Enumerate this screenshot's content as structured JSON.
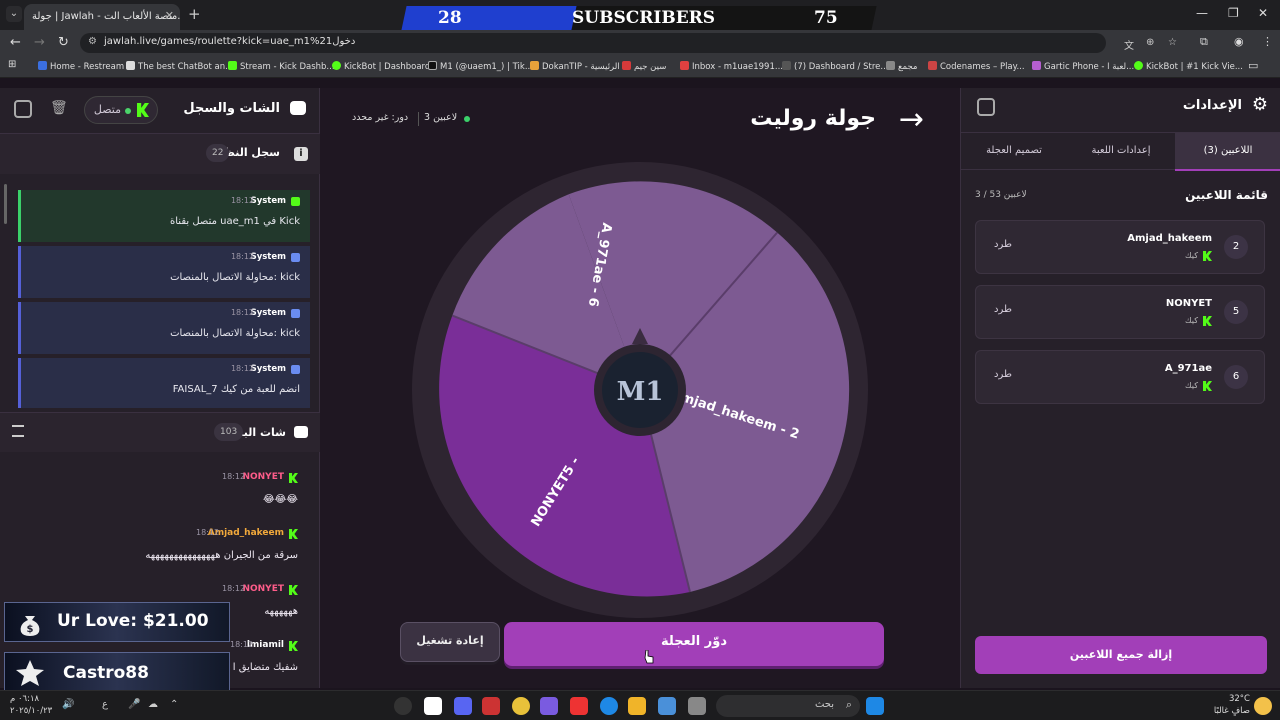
{
  "browser": {
    "tab_title": "جولة | Jawlah - منصة الألعاب الت...",
    "url": "jawlah.live/games/roulette?kick=uae_m1%21دخول",
    "bookmarks": [
      "Home - Restream",
      "The best ChatBot an...",
      "Stream - Kick Dashb...",
      "KickBot | Dashboard",
      "M1 (@uaem1_) | Tik...",
      "DokanTIP - الرئيسية",
      "سين جيم",
      "Inbox - m1uae1991...",
      "(7) Dashboard / Stre...",
      "مجمع",
      "Codenames – Play...",
      "Gartic Phone - لعبة ا...",
      "KickBot | #1 Kick Vie..."
    ]
  },
  "subscribers_overlay": {
    "current": "28",
    "label": "SUBSCRIBERS",
    "goal": "75"
  },
  "chat_panel": {
    "title": "الشات والسجل",
    "status": "متصل",
    "system_log": {
      "title": "سجل النظام",
      "count": "22",
      "entries": [
        {
          "author": "System",
          "time": "18:12",
          "message": "متصل بقناة uae_m1 في Kick",
          "kind": "success"
        },
        {
          "author": "System",
          "time": "18:12",
          "message": "محاولة الاتصال بالمنصات: kick",
          "kind": "info"
        },
        {
          "author": "System",
          "time": "18:12",
          "message": "محاولة الاتصال بالمنصات: kick",
          "kind": "info"
        },
        {
          "author": "System",
          "time": "18:12",
          "message": "FAISAL_7 انضم للعبة من كيك",
          "kind": "info"
        }
      ]
    },
    "live_chat": {
      "title": "شات البث",
      "count": "103",
      "messages": [
        {
          "user": "NONYET‪‏",
          "time": "18:12",
          "text": "😂😂😂",
          "color": "#ff5c8a"
        },
        {
          "user": "Amjad_hakeem",
          "time": "18:12",
          "text": "سرقة من الجيران هههههههههههههههه",
          "color": "#f2a93b"
        },
        {
          "user": "NONYET‪‏",
          "time": "18:12",
          "text": "ههههههه",
          "color": "#ff5c8a"
        },
        {
          "user": "lmiamil",
          "time": "18:12",
          "text": "شفيك متضايق ا",
          "color": "#ffffff"
        }
      ]
    }
  },
  "overlays": {
    "love": "Ur Love: $21.00",
    "supporter": "Castro88"
  },
  "game": {
    "title": "جولة روليت",
    "players_online": "3 لاعبين",
    "turn": "دور: غير محدد",
    "center_logo": "M1",
    "wheel_segments": [
      "A_971ae - 6",
      "Amjad_hakeem - 2",
      "NONYET‪‏ - 5"
    ],
    "spin_button": "دوّر العجلة",
    "reset_button": "إعادة تشغيل"
  },
  "settings": {
    "title": "الإعدادات",
    "tabs": [
      "اللاعبين (3)",
      "إعدادات اللعبة",
      "تصميم العجلة"
    ],
    "list_title": "قائمة اللاعبين",
    "list_count": "3 / 53 لاعبين",
    "players": [
      {
        "num": "2",
        "name": "Amjad_hakeem",
        "platform": "كيك",
        "kick": "طرد"
      },
      {
        "num": "5",
        "name": "NONYET‪‏",
        "platform": "كيك",
        "kick": "طرد"
      },
      {
        "num": "6",
        "name": "A_971ae",
        "platform": "كيك",
        "kick": "طرد"
      }
    ],
    "remove_all": "إزالة جميع اللاعبين"
  },
  "taskbar": {
    "search": "بحث",
    "time": "٠٦:١٨ م",
    "date": "٢٠٢٥/١٠/٢٣",
    "temperature": "32°C",
    "weather": "صافٍ غالبًا",
    "lang": "ع"
  },
  "colors": {
    "accent": "#a23fb8",
    "kick_green": "#53fc18",
    "wheel_dark": "#7a2e98",
    "wheel_light": "#7d5a92"
  }
}
